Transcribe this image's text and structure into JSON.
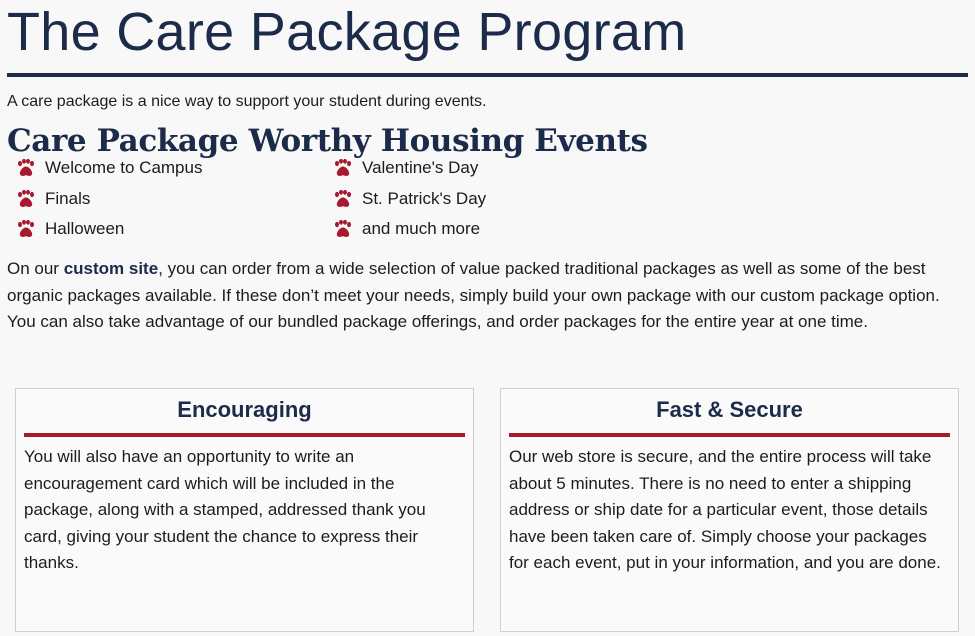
{
  "page": {
    "title": "The Care Package Program",
    "intro": "A care package is a nice way to support your student during events."
  },
  "events": {
    "heading": "Care Package Worthy Housing Events",
    "items": [
      "Welcome to Campus",
      "Finals",
      "Halloween",
      "Valentine's Day",
      "St. Patrick's Day",
      "and much more"
    ],
    "icon": "paw-icon",
    "icon_color": "#a6192e"
  },
  "body": {
    "prefix": "On our ",
    "link_text": "custom site",
    "suffix": ", you can order from a wide selection of value packed traditional packages as well as some of the best organic packages available. If these don’t meet your needs, simply build your own package with our custom package option. You can also take advantage of our bundled package offerings, and order packages for the entire year at one time."
  },
  "cards": [
    {
      "title": "Encouraging",
      "text": "You will also have an opportunity to write an encouragement card which will be included in the package, along with a stamped, addressed thank you card, giving your student the chance to express their thanks."
    },
    {
      "title": "Fast & Secure",
      "text": "Our web store is secure, and the entire process will take about 5 minutes. There is no need to enter a shipping address or ship date for a particular event, those details have been taken care of. Simply choose your packages for each event, put in your information, and you are done."
    }
  ],
  "colors": {
    "navy": "#1c2b4a",
    "accent_red": "#a6192e"
  }
}
